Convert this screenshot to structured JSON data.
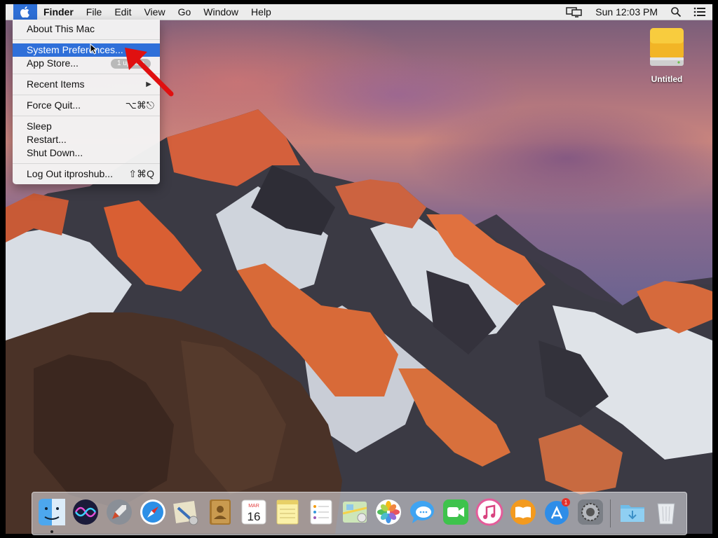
{
  "menubar": {
    "apple_icon": "apple-logo-icon",
    "app_name": "Finder",
    "menus": [
      "File",
      "Edit",
      "View",
      "Go",
      "Window",
      "Help"
    ],
    "clock": "Sun 12:03 PM",
    "status_icons": [
      "display-mirroring-icon",
      "spotlight-search-icon",
      "notification-center-icon"
    ]
  },
  "apple_menu": {
    "about": "About This Mac",
    "system_preferences": "System Preferences...",
    "app_store": "App Store...",
    "app_store_badge": "1 update",
    "recent_items": "Recent Items",
    "force_quit": "Force Quit...",
    "force_quit_shortcut": "⌥⌘⎋",
    "sleep": "Sleep",
    "restart": "Restart...",
    "shut_down": "Shut Down...",
    "log_out": "Log Out itproshub...",
    "log_out_shortcut": "⇧⌘Q"
  },
  "desktop": {
    "drive_label": "Untitled",
    "drive_icon": "external-drive-icon"
  },
  "dock": {
    "apps": [
      "finder-icon",
      "siri-icon",
      "launchpad-icon",
      "safari-icon",
      "mail-icon",
      "contacts-icon",
      "calendar-icon",
      "notes-icon",
      "reminders-icon",
      "maps-icon",
      "photos-icon",
      "messages-icon",
      "facetime-icon",
      "itunes-icon",
      "ibooks-icon",
      "app-store-icon",
      "system-preferences-icon",
      "downloads-folder-icon",
      "trash-icon"
    ],
    "calendar_month": "MAR",
    "calendar_day": "16",
    "app_store_badge": "1"
  },
  "colors": {
    "menu_highlight": "#2f6fd9",
    "annotation_arrow": "#e01010"
  }
}
